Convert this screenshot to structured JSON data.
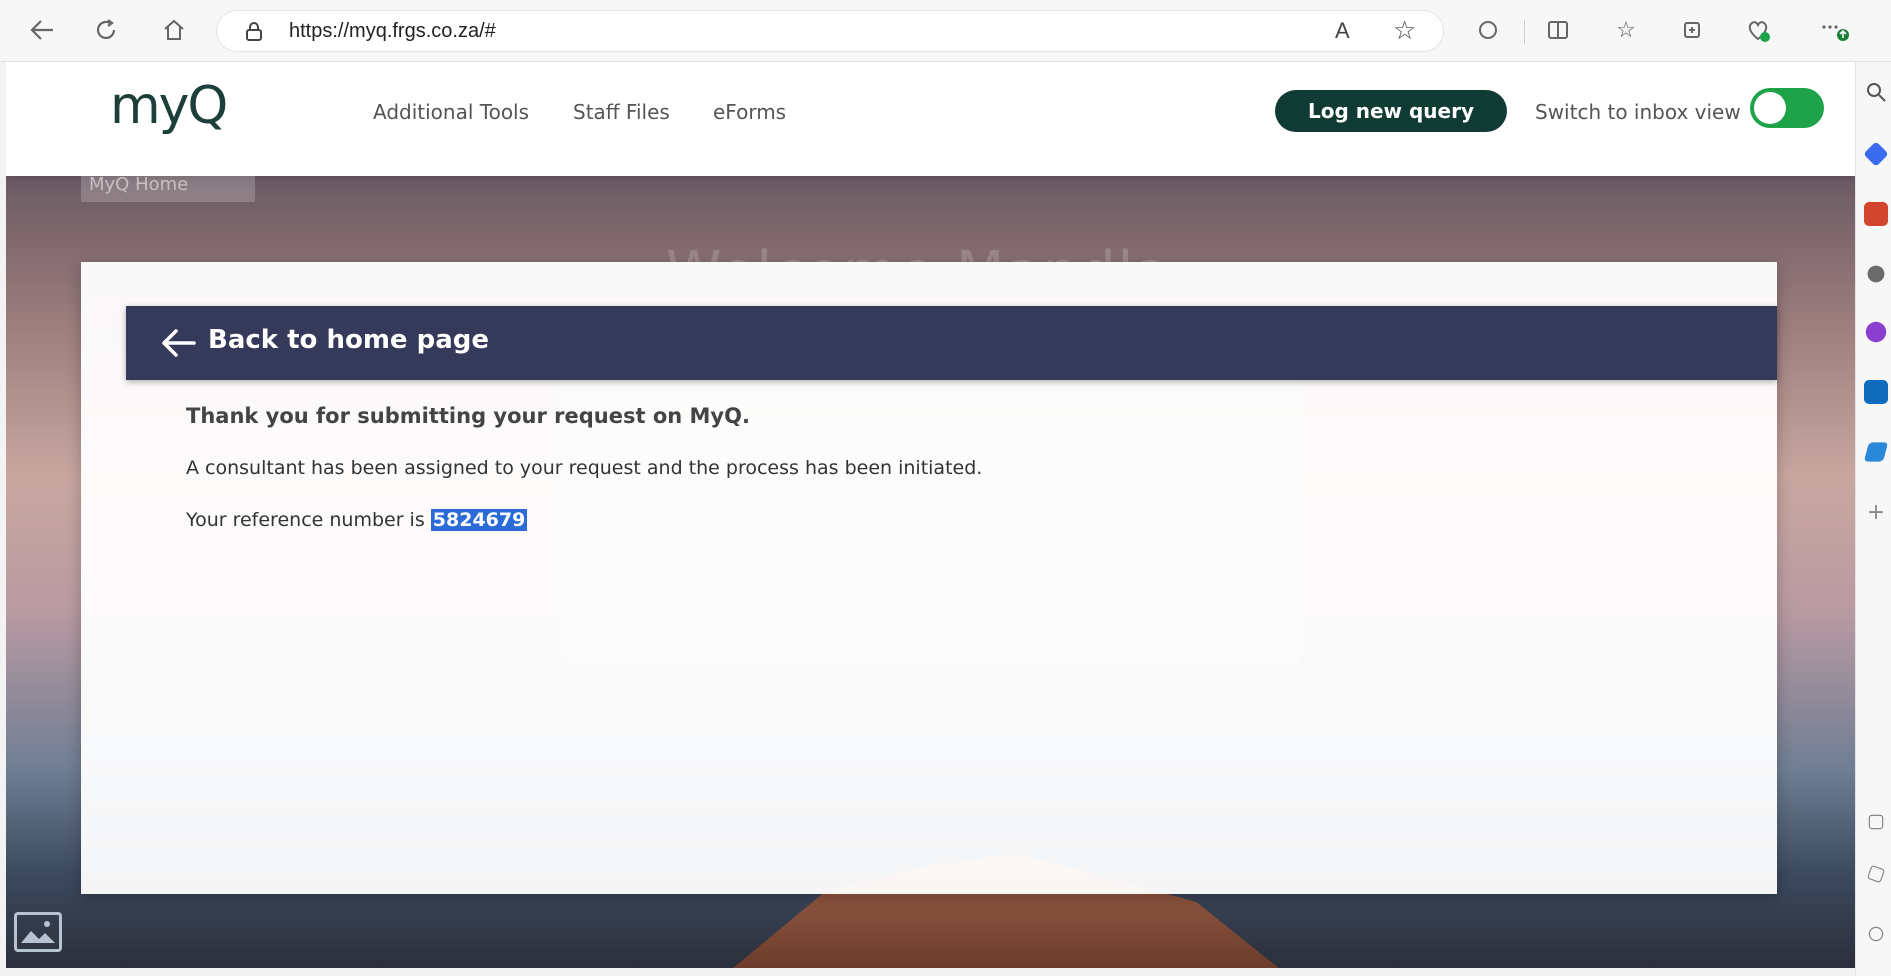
{
  "browser": {
    "url": "https://myq.frgs.co.za/#",
    "read_aloud_label": "A"
  },
  "header": {
    "logo_text": "myQ",
    "nav": [
      "Additional Tools",
      "Staff Files",
      "eForms"
    ],
    "log_query_label": "Log new query",
    "switch_label": "Switch to inbox view",
    "switch_on": true
  },
  "breadcrumb": "MyQ Home",
  "background_title": "Welcome Mandla",
  "back_label": "Back to home page",
  "message": {
    "title": "Thank you for submitting your request on MyQ.",
    "body": "A consultant has been assigned to your request and the process has been initiated.",
    "ref_prefix": "Your reference number is ",
    "ref_number": "5824679"
  },
  "colors": {
    "brand_dark": "#0f3b34",
    "back_bar": "#35395a",
    "toggle": "#1fa34a",
    "highlight": "#2a6bd8"
  }
}
